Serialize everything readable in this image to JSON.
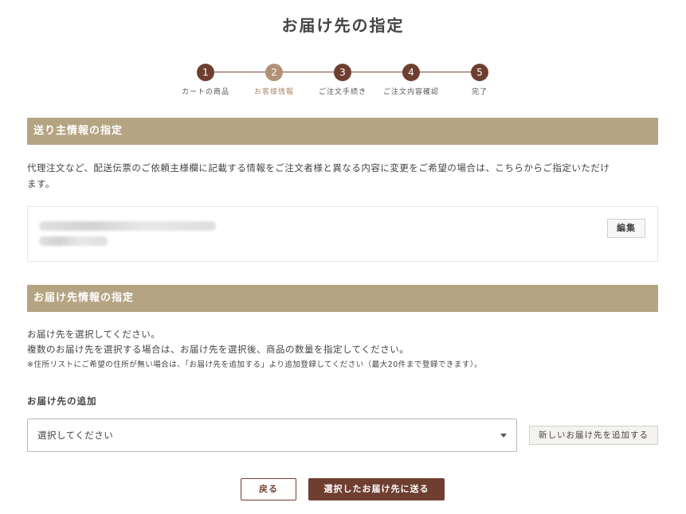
{
  "page": {
    "title": "お届け先の指定"
  },
  "steps": [
    {
      "number": "1",
      "label": "カートの商品"
    },
    {
      "number": "2",
      "label": "お客様情報"
    },
    {
      "number": "3",
      "label": "ご注文手続き"
    },
    {
      "number": "4",
      "label": "ご注文内容確認"
    },
    {
      "number": "5",
      "label": "完了"
    }
  ],
  "current_step": 2,
  "sender": {
    "header": "送り主情報の指定",
    "description_line1": "代理注文など、配送伝票のご依頼主様欄に記載する情報をご注文者様と異なる内容に変更をご希望の場合は、こちらからご指定いただけ",
    "description_line2": "ます。",
    "edit_label": "編集"
  },
  "delivery": {
    "header": "お届け先情報の指定",
    "note1": "お届け先を選択してください。",
    "note2": "複数のお届け先を選択する場合は、お届け先を選択後、商品の数量を指定してください。",
    "note3": "※住所リストにご希望の住所が無い場合は、「お届け先を追加する」より追加登録してください（最大20件まで登録できます）。",
    "add_label": "お届け先の追加",
    "select_value": "選択してください",
    "add_button": "新しいお届け先を追加する"
  },
  "actions": {
    "back": "戻る",
    "send": "選択したお届け先に送る"
  },
  "colors": {
    "accent": "#6e3f30",
    "header_bg": "#b5a482",
    "current_step": "#b09276"
  }
}
